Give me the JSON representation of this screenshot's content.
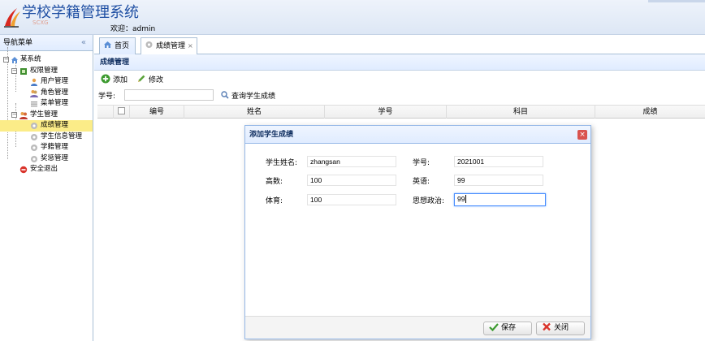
{
  "header": {
    "app_title": "学校学籍管理系统",
    "subtitle": "SCXG",
    "welcome_prefix": "欢迎：",
    "username": "admin"
  },
  "sidebar": {
    "title": "导航菜单",
    "collapse_glyph": "«",
    "tree": {
      "root": "某系统",
      "groups": [
        {
          "label": "权限管理",
          "items": [
            "用户管理",
            "角色管理",
            "菜单管理"
          ]
        },
        {
          "label": "学生管理",
          "items": [
            "成绩管理",
            "学生信息管理",
            "学籍管理",
            "奖惩管理"
          ]
        }
      ],
      "logout": "安全退出"
    },
    "selected_item": "成绩管理"
  },
  "tabs": [
    {
      "label": "首页",
      "icon": "home-icon"
    },
    {
      "label": "成绩管理",
      "icon": "gear-icon",
      "close": "×",
      "active": true
    }
  ],
  "panel": {
    "title": "成绩管理",
    "toolbar": {
      "add_label": "添加",
      "edit_label": "修改"
    },
    "search": {
      "label": "学号:",
      "value": "",
      "button_label": "查询学生成绩"
    },
    "columns": [
      "编号",
      "姓名",
      "学号",
      "科目",
      "成绩"
    ]
  },
  "dialog": {
    "title": "添加学生成绩",
    "close_glyph": "×",
    "fields": {
      "name": {
        "label": "学生姓名:",
        "value": "zhangsan"
      },
      "student_id": {
        "label": "学号:",
        "value": "2021001"
      },
      "math": {
        "label": "高数:",
        "value": "100"
      },
      "english": {
        "label": "英语:",
        "value": "99"
      },
      "pe": {
        "label": "体育:",
        "value": "100"
      },
      "politics": {
        "label": "思想政治:",
        "value": "99"
      }
    },
    "save_label": "保存",
    "close_label": "关闭"
  },
  "colors": {
    "accent": "#95b8e7",
    "title_blue": "#1f4fa3",
    "selected": "#fbec88"
  }
}
